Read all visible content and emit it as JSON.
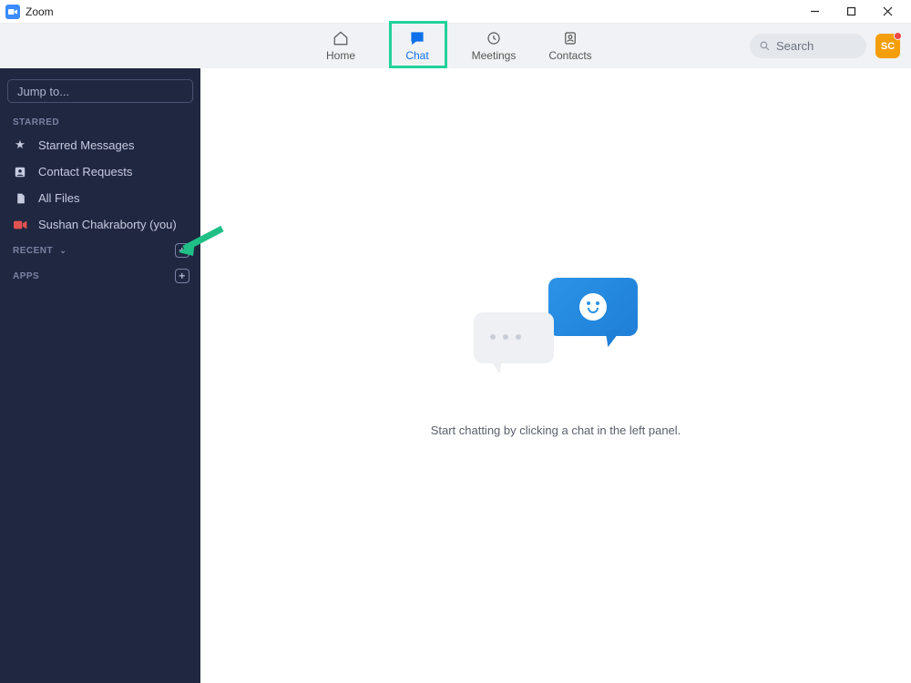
{
  "window": {
    "title": "Zoom"
  },
  "nav": {
    "tabs": [
      {
        "id": "home",
        "label": "Home"
      },
      {
        "id": "chat",
        "label": "Chat"
      },
      {
        "id": "meetings",
        "label": "Meetings"
      },
      {
        "id": "contacts",
        "label": "Contacts"
      }
    ],
    "active_tab": "chat",
    "search_placeholder": "Search",
    "avatar_initials": "SC"
  },
  "sidebar": {
    "jump_placeholder": "Jump to...",
    "sections": {
      "starred": {
        "label": "STARRED",
        "items": [
          {
            "id": "starred-messages",
            "label": "Starred Messages",
            "icon": "star-icon"
          },
          {
            "id": "contact-requests",
            "label": "Contact Requests",
            "icon": "contact-request-icon"
          },
          {
            "id": "all-files",
            "label": "All Files",
            "icon": "file-icon"
          },
          {
            "id": "self-chat",
            "label": "Sushan Chakraborty (you)",
            "icon": "video-icon"
          }
        ]
      },
      "recent": {
        "label": "RECENT"
      },
      "apps": {
        "label": "APPS"
      }
    }
  },
  "main": {
    "empty_message": "Start chatting by clicking a chat in the left panel."
  },
  "colors": {
    "accent": "#0e71eb",
    "sidebar_bg": "#1f2741",
    "highlight": "#23d19b"
  }
}
